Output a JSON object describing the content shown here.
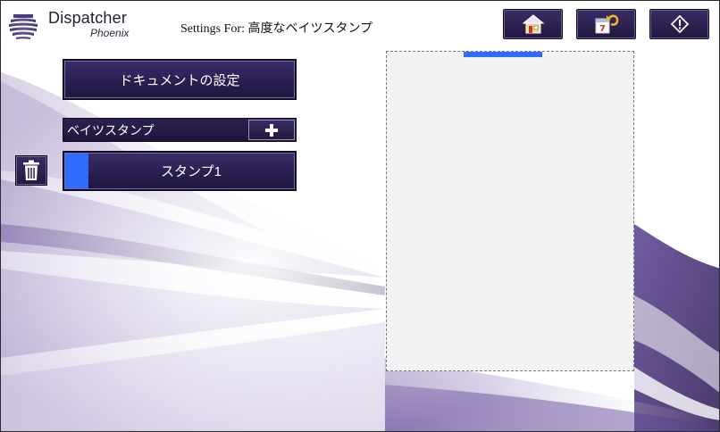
{
  "header": {
    "logo_title": "Dispatcher",
    "logo_subtitle": "Phoenix",
    "settings_for": "Settings For: 高度なベイツスタンプ",
    "buttons": [
      {
        "name": "home",
        "icon": "home-icon"
      },
      {
        "name": "reset",
        "icon": "calendar-undo-icon"
      },
      {
        "name": "info",
        "icon": "info-icon"
      }
    ]
  },
  "left_panel": {
    "document_settings_label": "ドキュメントの設定",
    "bates_stamp_label": "ベイツスタンプ",
    "stamps": [
      {
        "label": "スタンプ1",
        "selected": true
      }
    ]
  },
  "colors": {
    "button_dark": "#2a1f50",
    "accent_blue": "#2f6bff",
    "preview_bg": "#f3f3f3"
  }
}
